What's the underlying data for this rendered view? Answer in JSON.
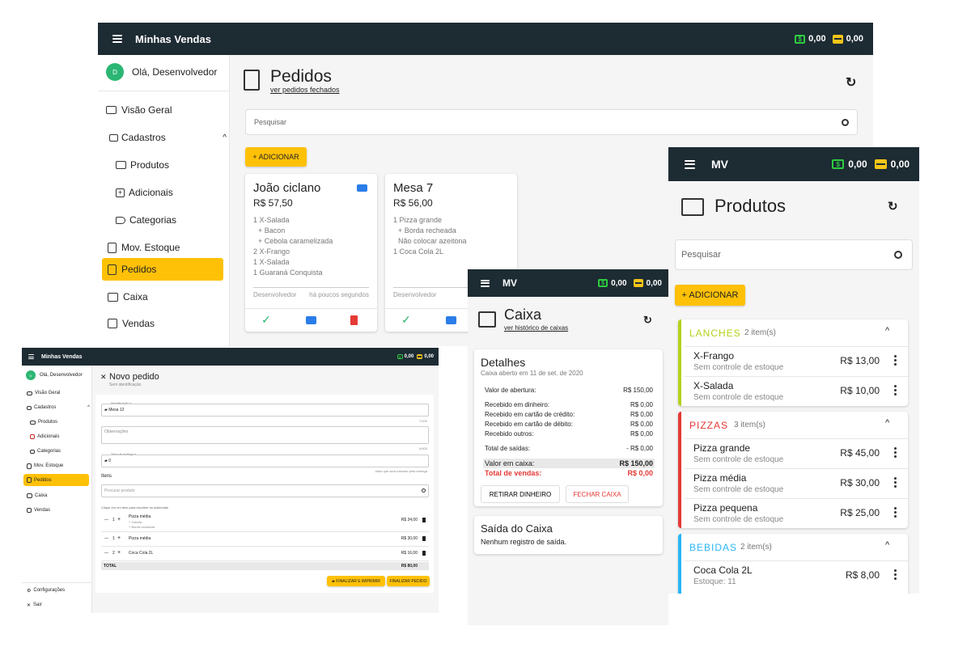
{
  "w1": {
    "title": "Minhas Vendas",
    "cash": "0,00",
    "card": "0,00",
    "user": {
      "initial": "D",
      "greeting": "Olá, Desenvolvedor"
    },
    "nav": [
      "Visão Geral",
      "Cadastros",
      "Produtos",
      "Adicionais",
      "Categorias",
      "Mov. Estoque",
      "Pedidos",
      "Caixa",
      "Vendas"
    ],
    "page_title": "Pedidos",
    "page_link": "ver pedidos fechados",
    "search_placeholder": "Pesquisar",
    "add_label": "+ ADICIONAR",
    "orders": [
      {
        "name": "João ciclano",
        "total": "R$ 57,50",
        "lines": [
          "1 X-Salada",
          "+ Bacon",
          "+ Cebola caramelizada",
          "2 X-Frango",
          "1 X-Salada",
          "1 Guaraná Conquista"
        ],
        "user": "Desenvolvedor",
        "time": "há poucos segundos"
      },
      {
        "name": "Mesa 7",
        "total": "R$ 56,00",
        "lines": [
          "1 Pizza grande",
          "+ Borda recheada",
          "Não colocar azeitona",
          "1 Coca Cola 2L"
        ],
        "user": "Desenvolvedor",
        "time": ""
      }
    ]
  },
  "w2": {
    "title": "Minhas Vendas",
    "cash": "0,00",
    "card": "0,00",
    "user": {
      "initial": "D",
      "greeting": "Olá, Desenvolvedor"
    },
    "nav": [
      "Visão Geral",
      "Cadastros",
      "Produtos",
      "Adicionais",
      "Categorias",
      "Mov. Estoque",
      "Pedidos",
      "Caixa",
      "Vendas"
    ],
    "bottom_nav": [
      "Configurações",
      "Sair"
    ],
    "form_title": "Novo pedido",
    "form_sub": "Sem identificação",
    "f_ident_label": "Identificação *",
    "f_ident_value": "Mesa 12",
    "f_ident_count": "7/100",
    "f_obs_label": "Observações",
    "f_obs_count": "0/400",
    "f_fee_label": "Taxa de entrega *",
    "f_fee_value": "0",
    "f_fee_hint": "Valor que será cobrado pela entrega",
    "items_label": "Itens",
    "items_search": "Procurar produto",
    "items_hint": "Clique em um item para escolher os adicionais",
    "items": [
      {
        "qty": "1",
        "name": "Pizza média",
        "extras": [
          "+ Cebola",
          "+ Borda recheada"
        ],
        "price": "R$ 34,00"
      },
      {
        "qty": "1",
        "name": "Pizza média",
        "extras": [],
        "price": "R$ 30,00"
      },
      {
        "qty": "2",
        "name": "Coca Cola 2L",
        "extras": [],
        "price": "R$ 16,00"
      }
    ],
    "total_label": "TOTAL",
    "total_value": "R$ 80,00",
    "btn_print": "FINALIZAR E IMPRIMIR",
    "btn_finish": "FINALIZAR PEDIDO"
  },
  "w3": {
    "title": "MV",
    "cash": "0,00",
    "card": "0,00",
    "page_title": "Caixa",
    "page_link": "ver histórico de caixas",
    "details_title": "Detalhes",
    "details_sub": "Caixa aberto em 11 de set. de 2020",
    "rows": [
      {
        "label": "Valor de abertura:",
        "value": "R$ 150,00"
      },
      {
        "label": "Recebido em dinheiro:",
        "value": "R$ 0,00"
      },
      {
        "label": "Recebido em cartão de crédito:",
        "value": "R$ 0,00"
      },
      {
        "label": "Recebido em cartão de débito:",
        "value": "R$ 0,00"
      },
      {
        "label": "Recebido outros:",
        "value": "R$ 0,00"
      },
      {
        "label": "Total de saídas:",
        "value": "- R$ 0,00"
      }
    ],
    "cash_label": "Valor em caixa:",
    "cash_value": "R$ 150,00",
    "sales_label": "Total de vendas:",
    "sales_value": "R$ 0,00",
    "btn_withdraw": "RETIRAR DINHEIRO",
    "btn_close": "FECHAR CAIXA",
    "out_title": "Saída do Caixa",
    "out_text": "Nenhum registro de saída."
  },
  "w4": {
    "title": "MV",
    "cash": "0,00",
    "card": "0,00",
    "page_title": "Produtos",
    "search_placeholder": "Pesquisar",
    "add_label": "+ ADICIONAR",
    "groups": [
      {
        "name": "LANCHES",
        "count": "2 item(s)",
        "color": "#b5d11b",
        "items": [
          {
            "name": "X-Frango",
            "sub": "Sem controle de estoque",
            "price": "R$ 13,00"
          },
          {
            "name": "X-Salada",
            "sub": "Sem controle de estoque",
            "price": "R$ 10,00"
          }
        ]
      },
      {
        "name": "PIZZAS",
        "count": "3 item(s)",
        "color": "#e53935",
        "items": [
          {
            "name": "Pizza grande",
            "sub": "Sem controle de estoque",
            "price": "R$ 45,00"
          },
          {
            "name": "Pizza média",
            "sub": "Sem controle de estoque",
            "price": "R$ 30,00"
          },
          {
            "name": "Pizza pequena",
            "sub": "Sem controle de estoque",
            "price": "R$ 25,00"
          }
        ]
      },
      {
        "name": "BEBIDAS",
        "count": "2 item(s)",
        "color": "#29b6f6",
        "items": [
          {
            "name": "Coca Cola 2L",
            "sub": "Estoque: 11",
            "price": "R$ 8,00"
          }
        ]
      }
    ]
  }
}
